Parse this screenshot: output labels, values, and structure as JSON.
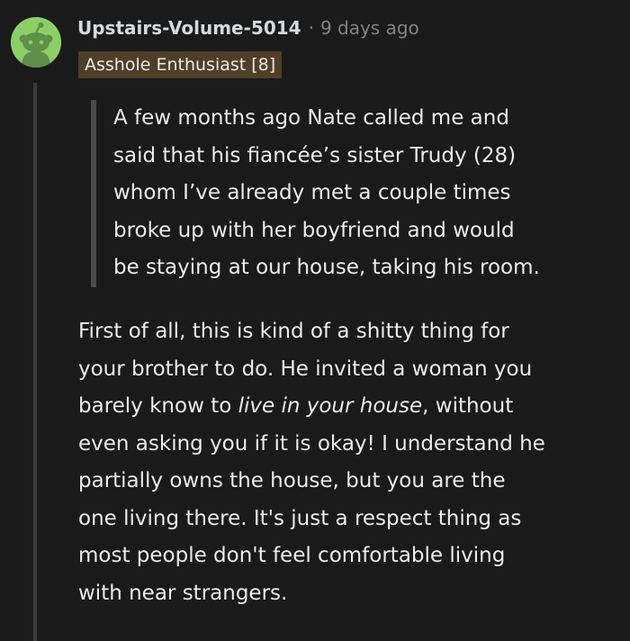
{
  "comment": {
    "username": "Upstairs-Volume-5014",
    "separator": "·",
    "time_ago": "9 days ago",
    "flair": "Asshole Enthusiast [8]",
    "quote_lines": [
      "A few months ago Nate called me and",
      "said that his fiancée’s sister Trudy (28)",
      "whom I’ve already met a couple times",
      "broke up with her boyfriend and would",
      "be staying at our house, taking his room."
    ],
    "body": {
      "line1": "First of all, this is kind of a shitty thing for",
      "line2": "your brother to do. He invited a woman you",
      "line3_before": "barely know to ",
      "line3_em": "live in your house",
      "line3_after": ", without",
      "line4": "even asking you if it is okay! I understand he",
      "line5": "partially owns the house, but you are the",
      "line6": "one living there. It's just a respect thing as",
      "line7": "most people don't feel comfortable living",
      "line8": "with near strangers."
    }
  },
  "colors": {
    "background": "#1a1a1b",
    "avatar_bg": "#8bd066",
    "flair_bg": "#4e3f26",
    "quote_bar": "#4a4a4b",
    "meta_text": "#818384"
  },
  "icons": {
    "avatar": "snoo-avatar-icon"
  }
}
